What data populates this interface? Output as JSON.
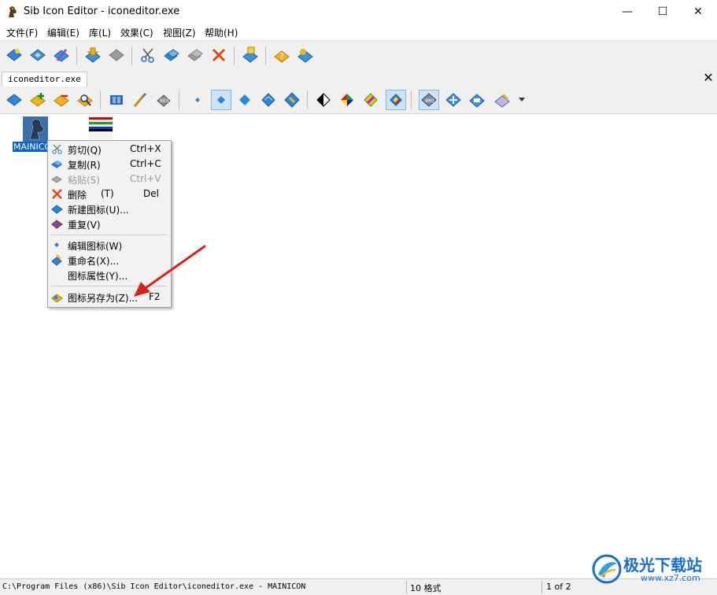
{
  "window": {
    "title": "Sib Icon Editor - iconeditor.exe",
    "controls": {
      "minimize": "—",
      "maximize": "☐",
      "close": "✕"
    }
  },
  "menu": [
    "文件(F)",
    "编辑(E)",
    "库(L)",
    "效果(C)",
    "视图(Z)",
    "帮助(H)"
  ],
  "toolbar_main": [
    "new-icon-icon",
    "open-icon",
    "wand-icon",
    "save-icon",
    "save-disabled-icon",
    "cut-icon",
    "copy-icon",
    "paste-icon",
    "delete-icon",
    "export-icon",
    "help-icon",
    "about-icon"
  ],
  "tab": {
    "label": "iconeditor.exe",
    "close": "✕"
  },
  "toolbar_icons": [
    "new-image-icon",
    "add-image-icon",
    "remove-image-icon",
    "find-image-icon",
    "film-icon",
    "brush-icon",
    "res-icon",
    "size-16-icon",
    "size-24-icon",
    "size-32-icon",
    "size-48-icon",
    "size-64-icon",
    "mono-icon",
    "color-16-icon",
    "color-256-icon",
    "color-true-icon",
    "img-icon",
    "layout-icon",
    "preview-icon",
    "properties-icon"
  ],
  "icons_list": [
    {
      "label": "MAINICON",
      "selected": true
    },
    {
      "label": "",
      "selected": false
    }
  ],
  "context_menu": {
    "items": [
      {
        "label": "剪切(Q)",
        "shortcut": "Ctrl+X",
        "icon": "cut-icon",
        "disabled": false
      },
      {
        "label": "复制(R)",
        "shortcut": "Ctrl+C",
        "icon": "copy-icon",
        "disabled": false
      },
      {
        "label": "粘贴(S)",
        "shortcut": "Ctrl+V",
        "icon": "paste-icon",
        "disabled": true
      },
      {
        "label": "删除",
        "hotkey": "(T)",
        "shortcut": "Del",
        "icon": "delete-icon",
        "disabled": false
      },
      {
        "label": "新建图标(U)...",
        "shortcut": "",
        "icon": "new-icon-icon",
        "disabled": false
      },
      {
        "label": "重复(V)",
        "shortcut": "",
        "icon": "duplicate-icon",
        "disabled": false
      },
      {
        "label": "编辑图标(W)",
        "shortcut": "",
        "icon": "edit-icon",
        "disabled": false
      },
      {
        "label": "重命名(X)...",
        "shortcut": "",
        "icon": "rename-icon",
        "disabled": false
      },
      {
        "label": "图标属性(Y)...",
        "shortcut": "",
        "icon": "",
        "disabled": false
      },
      {
        "label": "图标另存为(Z)...",
        "shortcut": "F2",
        "icon": "save-as-icon",
        "disabled": false
      }
    ]
  },
  "status": {
    "path": "C:\\Program Files (x86)\\Sib Icon Editor\\iconeditor.exe - MAINICON",
    "formats": "10 格式",
    "page": "1 of 2"
  },
  "watermark": {
    "name": "极光下载站",
    "url": "www.xz7.com"
  },
  "colors": {
    "accent": "#1a6fc4",
    "selection": "#0a64c8",
    "arrow": "#d9211e"
  }
}
